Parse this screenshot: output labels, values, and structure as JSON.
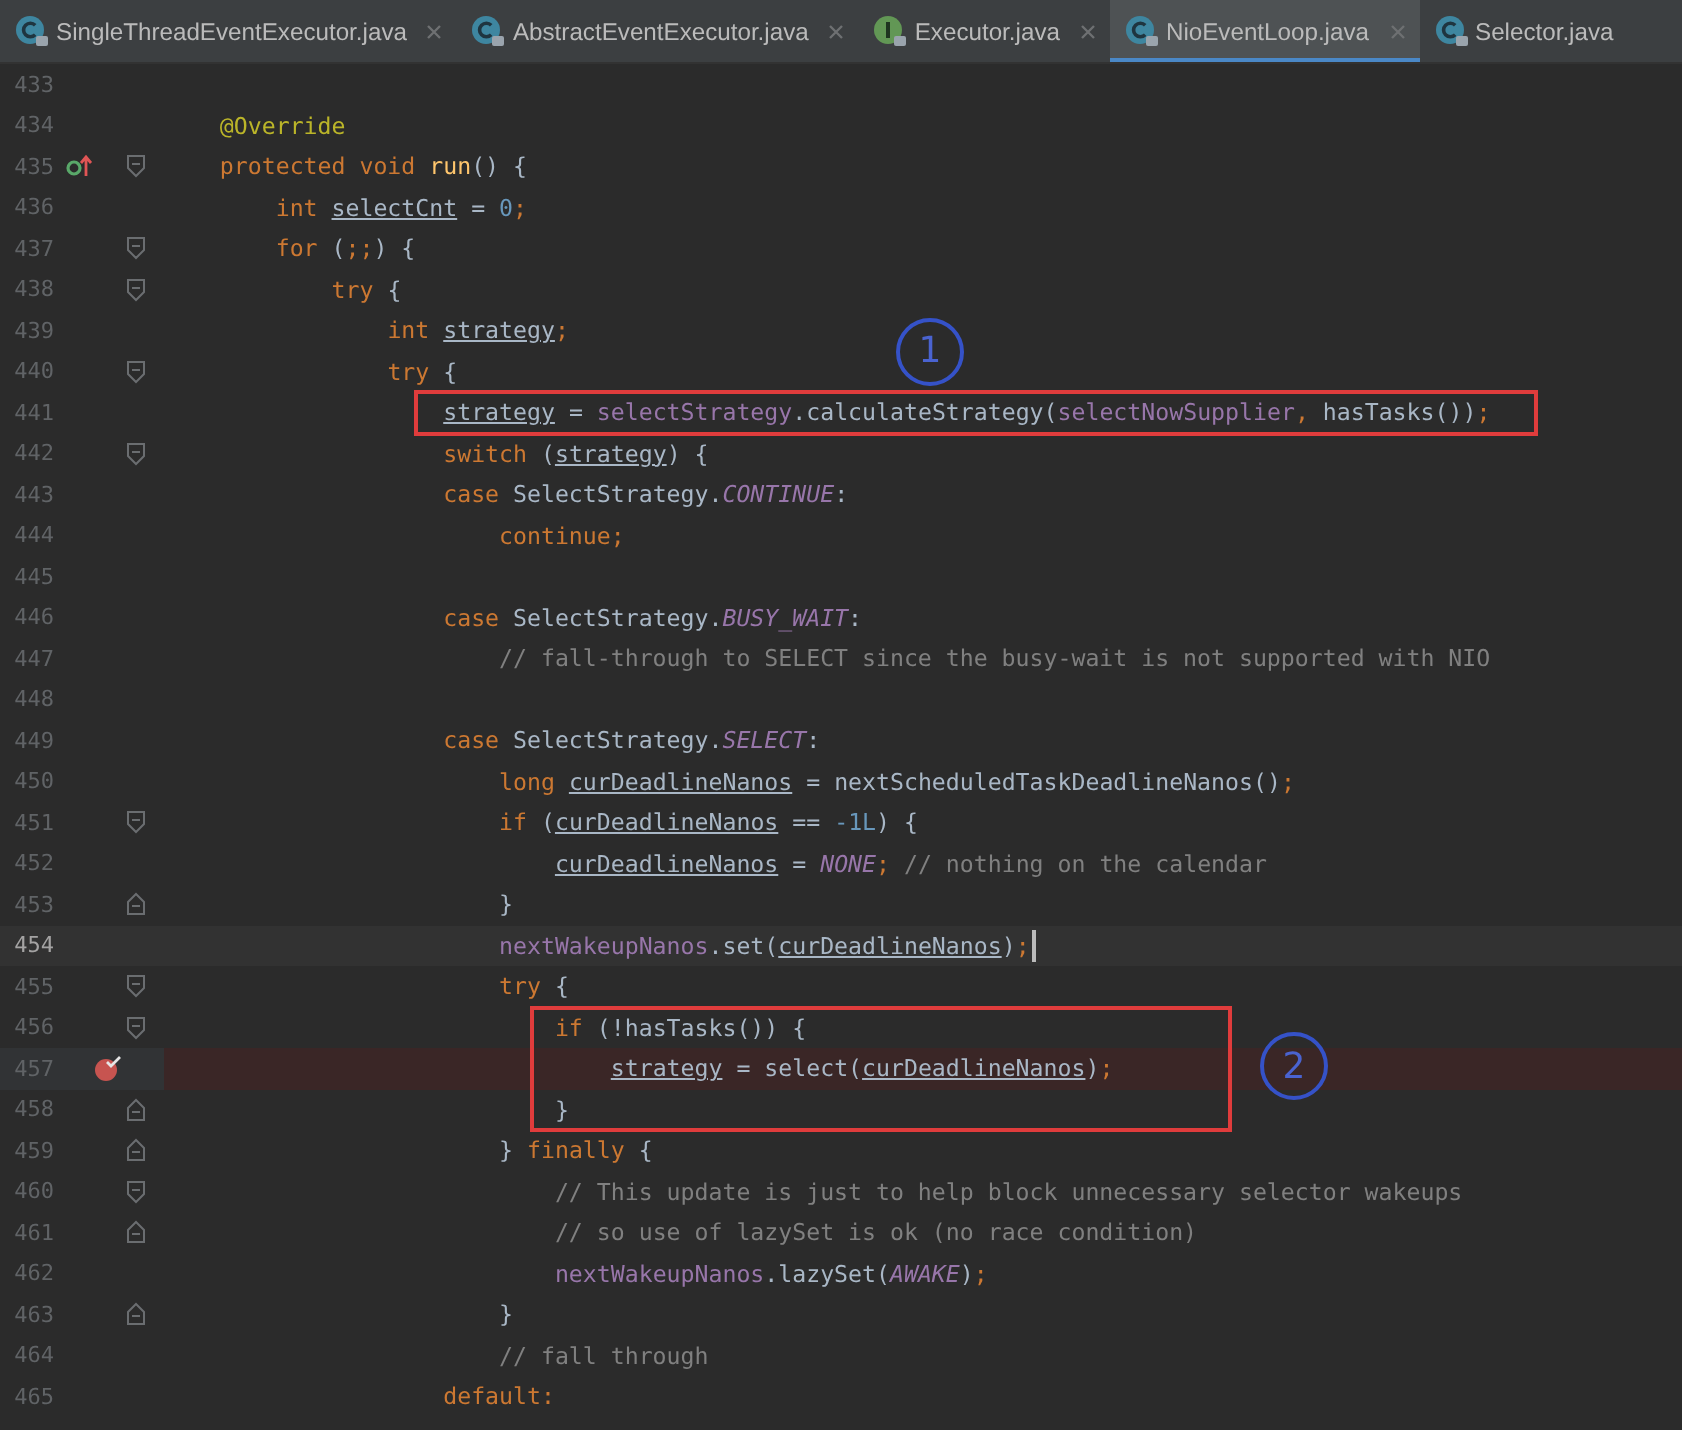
{
  "tabs": [
    {
      "label": "SingleThreadEventExecutor.java",
      "kind": "class",
      "selected": false,
      "closable": true
    },
    {
      "label": "AbstractEventExecutor.java",
      "kind": "class",
      "selected": false,
      "closable": true
    },
    {
      "label": "Executor.java",
      "kind": "interface",
      "selected": false,
      "closable": true
    },
    {
      "label": "NioEventLoop.java",
      "kind": "class",
      "selected": true,
      "closable": true
    },
    {
      "label": "Selector.java",
      "kind": "class",
      "selected": false,
      "closable": false
    }
  ],
  "editor": {
    "lines": [
      {
        "number": "433"
      },
      {
        "number": "434",
        "tokens": [
          {
            "t": "    @Override",
            "kind": "ann"
          }
        ]
      },
      {
        "number": "435",
        "marker": {
          "kind": "override"
        },
        "fold": {
          "kind": "start"
        },
        "tokens": [
          {
            "t": "    protected void ",
            "kind": "kw"
          },
          {
            "t": "run",
            "kind": "decl"
          },
          {
            "t": "() {",
            "kind": "plain"
          }
        ]
      },
      {
        "number": "436",
        "tokens": [
          {
            "t": "        int ",
            "kind": "kw"
          },
          {
            "t": "selectCnt",
            "kind": "var"
          },
          {
            "t": " = ",
            "kind": "plain"
          },
          {
            "t": "0",
            "kind": "num"
          },
          {
            "t": ";",
            "kind": "kw"
          }
        ]
      },
      {
        "number": "437",
        "fold": {
          "kind": "start"
        },
        "tokens": [
          {
            "t": "        for ",
            "kind": "kw"
          },
          {
            "t": "(",
            "kind": "plain"
          },
          {
            "t": ";;",
            "kind": "kw"
          },
          {
            "t": ") {",
            "kind": "plain"
          }
        ]
      },
      {
        "number": "438",
        "fold": {
          "kind": "start"
        },
        "tokens": [
          {
            "t": "            try ",
            "kind": "kw"
          },
          {
            "t": "{",
            "kind": "plain"
          }
        ]
      },
      {
        "number": "439",
        "tokens": [
          {
            "t": "                int ",
            "kind": "kw"
          },
          {
            "t": "strategy",
            "kind": "var"
          },
          {
            "t": ";",
            "kind": "kw"
          }
        ]
      },
      {
        "number": "440",
        "fold": {
          "kind": "start"
        },
        "callout": "1",
        "tokens": [
          {
            "t": "                try ",
            "kind": "kw"
          },
          {
            "t": "{",
            "kind": "plain"
          }
        ]
      },
      {
        "number": "441",
        "boxed": true,
        "tokens": [
          {
            "t": "                    strategy",
            "kind": "var"
          },
          {
            "t": " = ",
            "kind": "plain"
          },
          {
            "t": "selectStrategy",
            "kind": "field"
          },
          {
            "t": ".calculateStrategy(",
            "kind": "plain"
          },
          {
            "t": "selectNowSupplier",
            "kind": "field"
          },
          {
            "t": ", ",
            "kind": "kw"
          },
          {
            "t": "hasTasks())",
            "kind": "plain"
          },
          {
            "t": ";",
            "kind": "kw"
          }
        ]
      },
      {
        "number": "442",
        "fold": {
          "kind": "start"
        },
        "tokens": [
          {
            "t": "                    switch ",
            "kind": "kw"
          },
          {
            "t": "(",
            "kind": "plain"
          },
          {
            "t": "strategy",
            "kind": "var"
          },
          {
            "t": ") {",
            "kind": "plain"
          }
        ]
      },
      {
        "number": "443",
        "tokens": [
          {
            "t": "                    case ",
            "kind": "kw"
          },
          {
            "t": "SelectStrategy.",
            "kind": "plain"
          },
          {
            "t": "CONTINUE",
            "kind": "const"
          },
          {
            "t": ":",
            "kind": "plain"
          }
        ]
      },
      {
        "number": "444",
        "tokens": [
          {
            "t": "                        continue;",
            "kind": "kw"
          }
        ]
      },
      {
        "number": "445"
      },
      {
        "number": "446",
        "tokens": [
          {
            "t": "                    case ",
            "kind": "kw"
          },
          {
            "t": "SelectStrategy.",
            "kind": "plain"
          },
          {
            "t": "BUSY_WAIT",
            "kind": "const"
          },
          {
            "t": ":",
            "kind": "plain"
          }
        ]
      },
      {
        "number": "447",
        "tokens": [
          {
            "t": "                        // fall-through to SELECT since the busy-wait is not supported with NIO",
            "kind": "comment"
          }
        ]
      },
      {
        "number": "448"
      },
      {
        "number": "449",
        "tokens": [
          {
            "t": "                    case ",
            "kind": "kw"
          },
          {
            "t": "SelectStrategy.",
            "kind": "plain"
          },
          {
            "t": "SELECT",
            "kind": "const"
          },
          {
            "t": ":",
            "kind": "plain"
          }
        ]
      },
      {
        "number": "450",
        "tokens": [
          {
            "t": "                        long ",
            "kind": "kw"
          },
          {
            "t": "curDeadlineNanos",
            "kind": "var"
          },
          {
            "t": " = nextScheduledTaskDeadlineNanos()",
            "kind": "plain"
          },
          {
            "t": ";",
            "kind": "kw"
          }
        ]
      },
      {
        "number": "451",
        "fold": {
          "kind": "start"
        },
        "tokens": [
          {
            "t": "                        if ",
            "kind": "kw"
          },
          {
            "t": "(",
            "kind": "plain"
          },
          {
            "t": "curDeadlineNanos",
            "kind": "var"
          },
          {
            "t": " == ",
            "kind": "plain"
          },
          {
            "t": "-1L",
            "kind": "num"
          },
          {
            "t": ") {",
            "kind": "plain"
          }
        ]
      },
      {
        "number": "452",
        "tokens": [
          {
            "t": "                            curDeadlineNanos",
            "kind": "var"
          },
          {
            "t": " = ",
            "kind": "plain"
          },
          {
            "t": "NONE",
            "kind": "const"
          },
          {
            "t": "; ",
            "kind": "kw"
          },
          {
            "t": "// nothing on the calendar",
            "kind": "comment"
          }
        ]
      },
      {
        "number": "453",
        "fold": {
          "kind": "end"
        },
        "tokens": [
          {
            "t": "                        }",
            "kind": "plain"
          }
        ]
      },
      {
        "number": "454",
        "current": true,
        "caret": true,
        "tokens": [
          {
            "t": "                        nextWakeupNanos",
            "kind": "field"
          },
          {
            "t": ".set(",
            "kind": "plain"
          },
          {
            "t": "curDeadlineNanos",
            "kind": "var"
          },
          {
            "t": ")",
            "kind": "plain"
          },
          {
            "t": ";",
            "kind": "kw"
          }
        ]
      },
      {
        "number": "455",
        "fold": {
          "kind": "start"
        },
        "tokens": [
          {
            "t": "                        try ",
            "kind": "kw"
          },
          {
            "t": "{",
            "kind": "plain"
          }
        ]
      },
      {
        "number": "456",
        "fold": {
          "kind": "start"
        },
        "boxed": true,
        "tokens": [
          {
            "t": "                            if ",
            "kind": "kw"
          },
          {
            "t": "(!hasTasks()) {",
            "kind": "plain"
          }
        ]
      },
      {
        "number": "457",
        "marker": {
          "kind": "breakpoint"
        },
        "breakpoint": true,
        "boxed": true,
        "callout": "2",
        "tokens": [
          {
            "t": "                                strategy",
            "kind": "var"
          },
          {
            "t": " = select(",
            "kind": "plain"
          },
          {
            "t": "curDeadlineNanos",
            "kind": "var"
          },
          {
            "t": ")",
            "kind": "plain"
          },
          {
            "t": ";",
            "kind": "kw"
          }
        ]
      },
      {
        "number": "458",
        "fold": {
          "kind": "end"
        },
        "boxed": true,
        "tokens": [
          {
            "t": "                            }",
            "kind": "plain"
          }
        ]
      },
      {
        "number": "459",
        "fold": {
          "kind": "end"
        },
        "tokens": [
          {
            "t": "                        } ",
            "kind": "plain"
          },
          {
            "t": "finally ",
            "kind": "kw"
          },
          {
            "t": "{",
            "kind": "plain"
          }
        ]
      },
      {
        "number": "460",
        "fold": {
          "kind": "start"
        },
        "tokens": [
          {
            "t": "                            // This update is just to help block unnecessary selector wakeups",
            "kind": "comment"
          }
        ]
      },
      {
        "number": "461",
        "fold": {
          "kind": "end"
        },
        "tokens": [
          {
            "t": "                            // so use of lazySet is ok (no race condition)",
            "kind": "comment"
          }
        ]
      },
      {
        "number": "462",
        "tokens": [
          {
            "t": "                            nextWakeupNanos",
            "kind": "field"
          },
          {
            "t": ".lazySet(",
            "kind": "plain"
          },
          {
            "t": "AWAKE",
            "kind": "const"
          },
          {
            "t": ")",
            "kind": "plain"
          },
          {
            "t": ";",
            "kind": "kw"
          }
        ]
      },
      {
        "number": "463",
        "fold": {
          "kind": "end"
        },
        "tokens": [
          {
            "t": "                        }",
            "kind": "plain"
          }
        ]
      },
      {
        "number": "464",
        "tokens": [
          {
            "t": "                        // fall through",
            "kind": "comment"
          }
        ]
      },
      {
        "number": "465",
        "tokens": [
          {
            "t": "                    default:",
            "kind": "kw"
          }
        ]
      }
    ]
  }
}
